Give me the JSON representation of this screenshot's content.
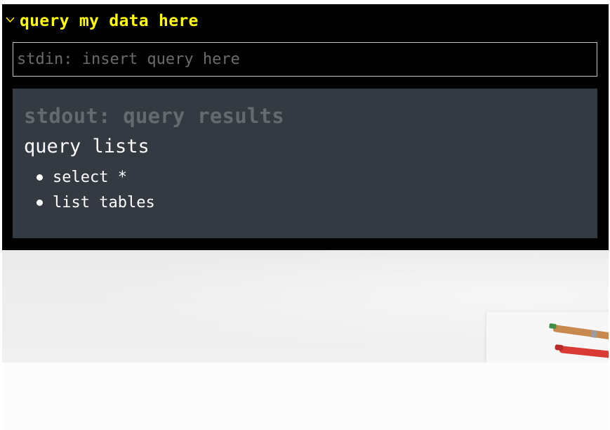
{
  "panel": {
    "title": "query my data here",
    "toggle_icon": "chevron-down-icon"
  },
  "stdin": {
    "placeholder": "stdin: insert query here",
    "value": ""
  },
  "stdout": {
    "heading": "stdout: query results",
    "lists_label": "query lists",
    "items": [
      {
        "label": "select *"
      },
      {
        "label": "list tables"
      }
    ]
  },
  "colors": {
    "terminal_background": "#000000",
    "title_accent": "#ffff00",
    "results_panel": "#343a42",
    "placeholder_text": "#6b6b6b",
    "heading_muted": "#656a70"
  }
}
